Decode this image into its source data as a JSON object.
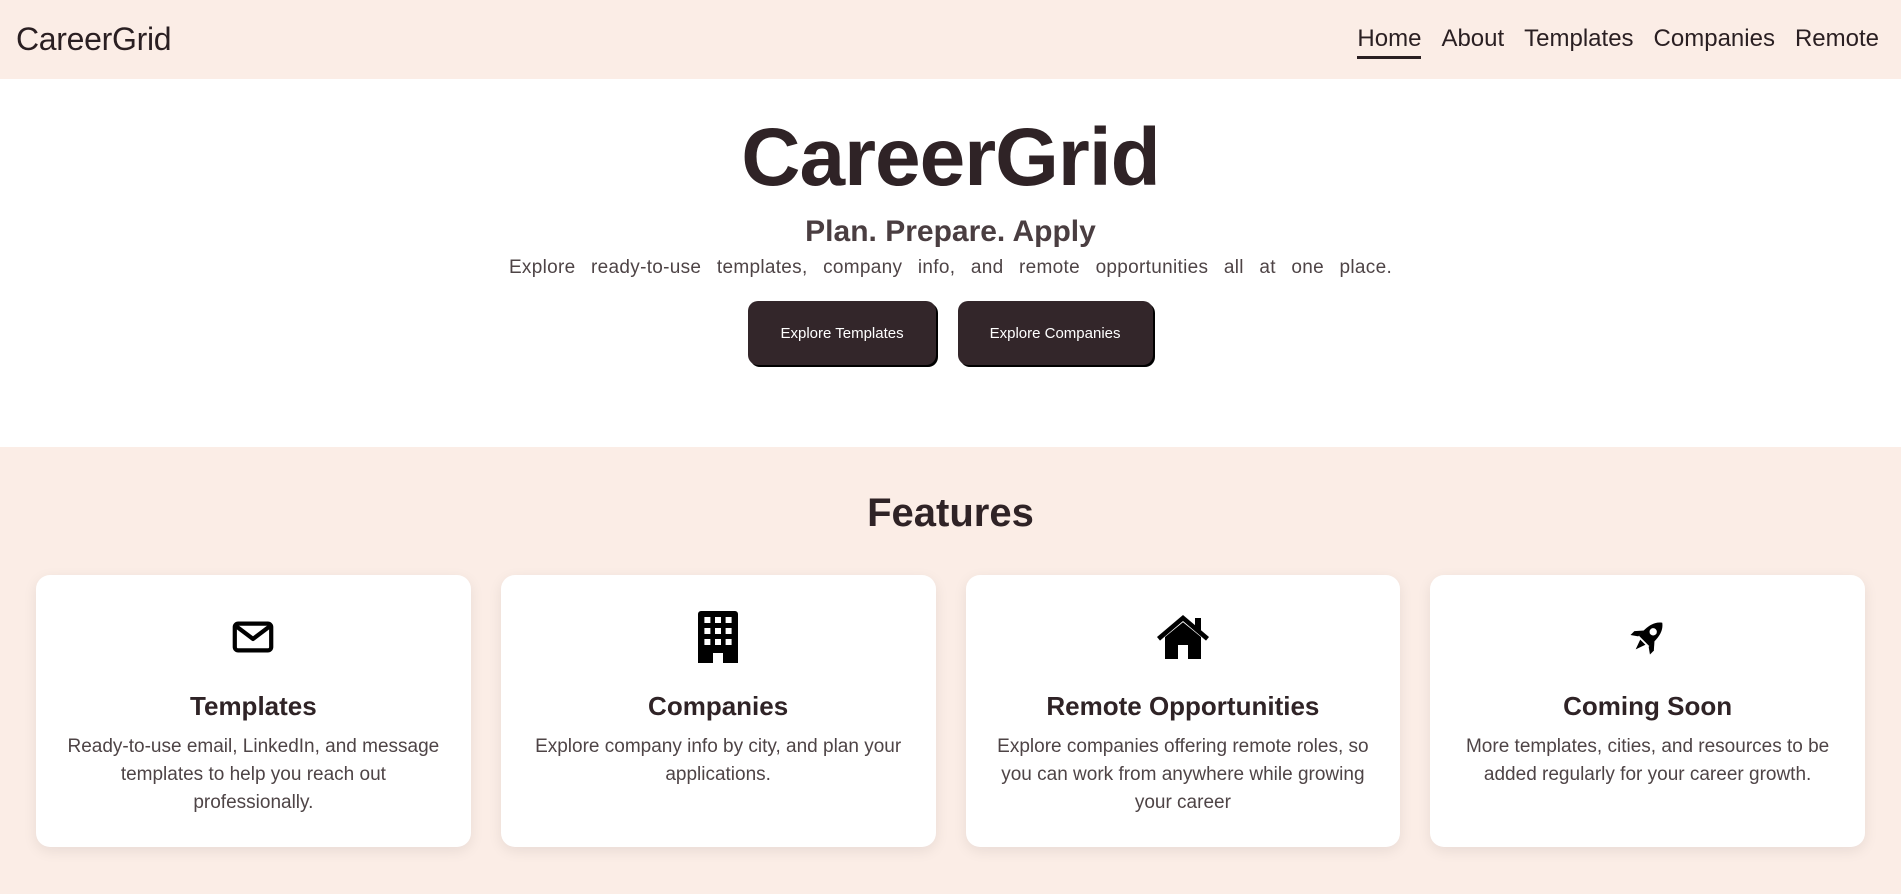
{
  "nav": {
    "brand": "CareerGrid",
    "links": [
      {
        "label": "Home",
        "active": true
      },
      {
        "label": "About",
        "active": false
      },
      {
        "label": "Templates",
        "active": false
      },
      {
        "label": "Companies",
        "active": false
      },
      {
        "label": "Remote",
        "active": false
      }
    ]
  },
  "hero": {
    "title": "CareerGrid",
    "tagline": "Plan. Prepare. Apply",
    "description": "Explore ready-to-use templates, company info, and remote opportunities all at one place.",
    "buttons": [
      {
        "label": "Explore Templates"
      },
      {
        "label": "Explore Companies"
      }
    ]
  },
  "features": {
    "title": "Features",
    "cards": [
      {
        "icon": "envelope-icon",
        "title": "Templates",
        "description": "Ready-to-use email, LinkedIn, and message templates to help you reach out professionally."
      },
      {
        "icon": "building-icon",
        "title": "Companies",
        "description": "Explore company info by city, and plan your applications."
      },
      {
        "icon": "house-icon",
        "title": "Remote Opportunities",
        "description": "Explore companies offering remote roles, so you can work from anywhere while growing your career"
      },
      {
        "icon": "rocket-icon",
        "title": "Coming Soon",
        "description": "More templates, cities, and resources to be added regularly for your career growth."
      }
    ]
  },
  "colors": {
    "nav_bg": "#fbede6",
    "primary_dark": "#33262a",
    "text": "#2f2326"
  }
}
